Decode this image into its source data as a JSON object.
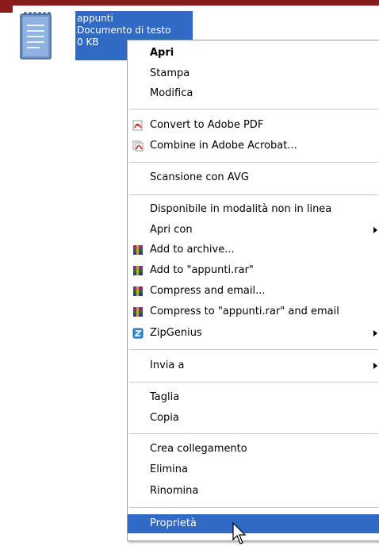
{
  "file": {
    "name": "appunti",
    "type": "Documento di testo",
    "size": "0 KB"
  },
  "menu": {
    "items": [
      {
        "label": "Apri"
      },
      {
        "label": "Stampa"
      },
      {
        "label": "Modifica"
      },
      {
        "label": "Convert to Adobe PDF"
      },
      {
        "label": "Combine in Adobe Acrobat..."
      },
      {
        "label": "Scansione con AVG"
      },
      {
        "label": "Disponibile in modalità non in linea"
      },
      {
        "label": "Apri con"
      },
      {
        "label": "Add to archive..."
      },
      {
        "label": "Add to \"appunti.rar\""
      },
      {
        "label": "Compress and email..."
      },
      {
        "label": "Compress to \"appunti.rar\" and email"
      },
      {
        "label": "ZipGenius"
      },
      {
        "label": "Invia a"
      },
      {
        "label": "Taglia"
      },
      {
        "label": "Copia"
      },
      {
        "label": "Crea collegamento"
      },
      {
        "label": "Elimina"
      },
      {
        "label": "Rinomina"
      },
      {
        "label": "Proprietà"
      }
    ]
  },
  "colors": {
    "selection": "#316ac5",
    "top_bar": "#8b1a1a"
  }
}
